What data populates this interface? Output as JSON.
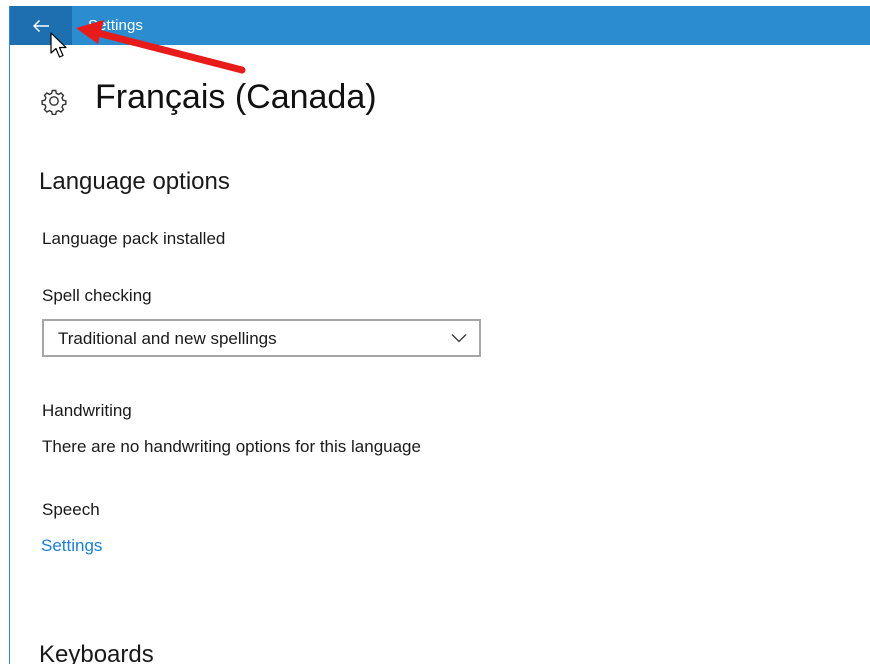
{
  "window": {
    "title": "Settings",
    "accent_color": "#2b8ccf",
    "back_button_color": "#1e6fb0",
    "back_icon": "arrow-left-icon"
  },
  "header": {
    "icon": "gear-icon",
    "title": "Français (Canada)"
  },
  "language_options": {
    "heading": "Language options",
    "language_pack_status": "Language pack installed",
    "spell_checking": {
      "label": "Spell checking",
      "selected_value": "Traditional and new spellings",
      "chevron_icon": "chevron-down-icon"
    },
    "handwriting": {
      "label": "Handwriting",
      "message": "There are no handwriting options for this language"
    },
    "speech": {
      "label": "Speech",
      "link_label": "Settings",
      "link_color": "#1a7fd6"
    }
  },
  "keyboards": {
    "heading": "Keyboards"
  },
  "annotation": {
    "arrow_color": "#e81b1b",
    "cursor_icon": "mouse-pointer-icon"
  }
}
